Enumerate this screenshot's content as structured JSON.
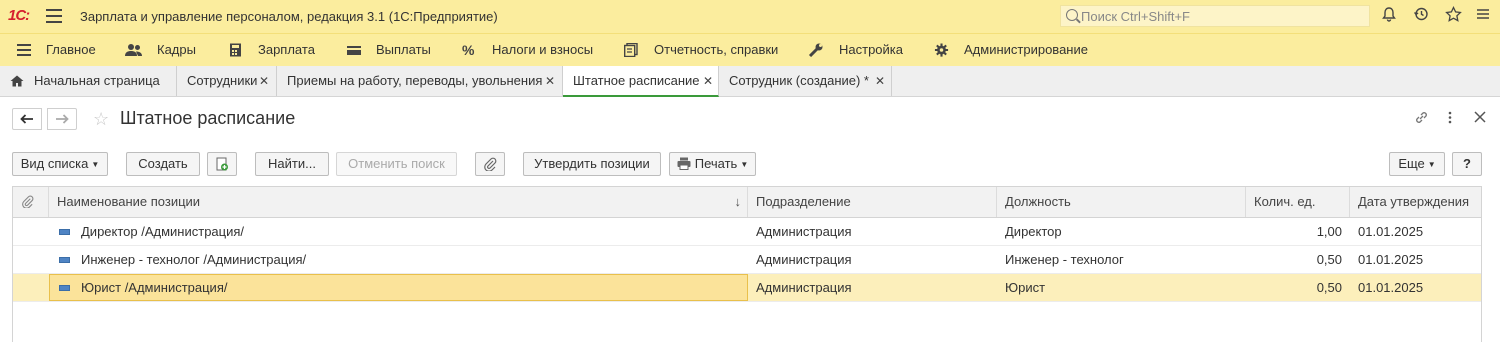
{
  "app": {
    "logo": "1С:",
    "title": "Зарплата и управление персоналом, редакция 3.1  (1С:Предприятие)",
    "search_placeholder": "Поиск Ctrl+Shift+F"
  },
  "titlebar_icons": [
    "bell-icon",
    "history-icon",
    "star-icon",
    "menu-icon"
  ],
  "sections": [
    {
      "label": "Главное",
      "icon": "menu-icon"
    },
    {
      "label": "Кадры",
      "icon": "people-icon"
    },
    {
      "label": "Зарплата",
      "icon": "calculator-icon"
    },
    {
      "label": "Выплаты",
      "icon": "wallet-icon"
    },
    {
      "label": "Налоги и взносы",
      "icon": "percent-icon"
    },
    {
      "label": "Отчетность, справки",
      "icon": "reports-icon"
    },
    {
      "label": "Настройка",
      "icon": "wrench-icon"
    },
    {
      "label": "Администрирование",
      "icon": "gear-icon"
    }
  ],
  "tabs": [
    {
      "label": "Начальная страница"
    },
    {
      "label": "Сотрудники"
    },
    {
      "label": "Приемы на работу, переводы, увольнения"
    },
    {
      "label": "Штатное расписание"
    },
    {
      "label": "Сотрудник (создание) *"
    }
  ],
  "form": {
    "title": "Штатное расписание"
  },
  "toolbar": {
    "view_list": "Вид списка",
    "create": "Создать",
    "find": "Найти...",
    "cancel_search": "Отменить поиск",
    "approve": "Утвердить позиции",
    "print": "Печать",
    "more": "Еще",
    "help": "?"
  },
  "table": {
    "columns": [
      "Наименование позиции",
      "Подразделение",
      "Должность",
      "Колич. ед.",
      "Дата утверждения"
    ],
    "sort_indicator": "↓",
    "rows": [
      {
        "name": "Директор /Администрация/",
        "department": "Администрация",
        "position": "Директор",
        "qty": "1,00",
        "date": "01.01.2025"
      },
      {
        "name": "Инженер - технолог /Администрация/",
        "department": "Администрация",
        "position": "Инженер - технолог",
        "qty": "0,50",
        "date": "01.01.2025"
      },
      {
        "name": "Юрист /Администрация/",
        "department": "Администрация",
        "position": "Юрист",
        "qty": "0,50",
        "date": "01.01.2025"
      }
    ]
  },
  "colors": {
    "header_bg": "#fbed9e",
    "selected_row": "#fcefbb",
    "active_tab_underline": "#3a9a3a"
  }
}
